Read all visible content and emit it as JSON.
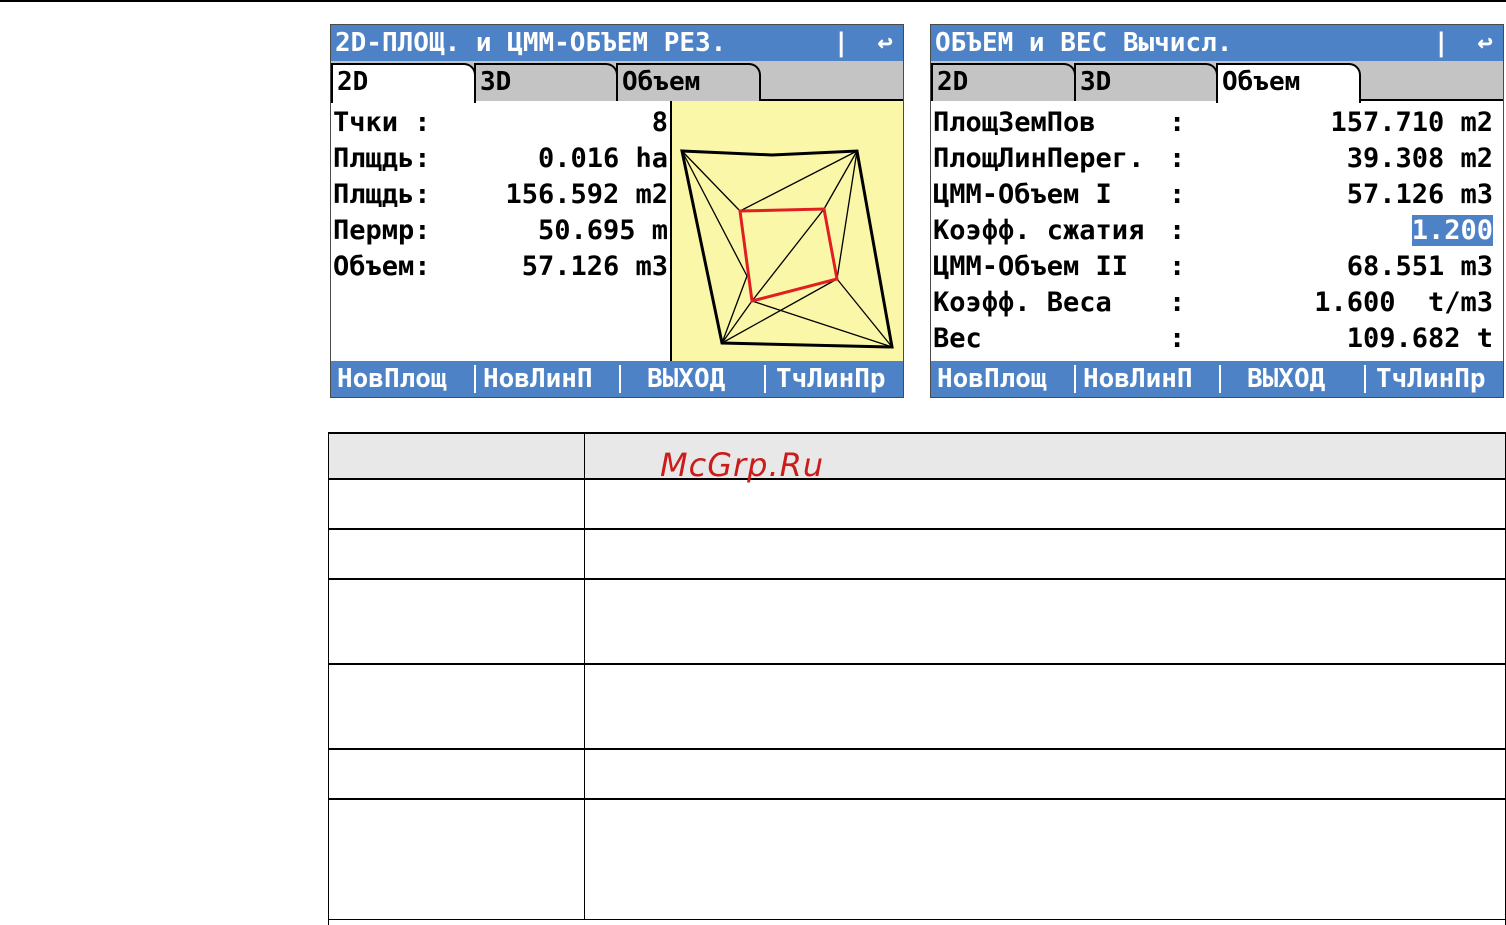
{
  "screen1": {
    "title": "2D-ПЛОЩ. и ЦММ-ОБЪЕМ РЕЗ.",
    "title_sep": "|",
    "back_icon": "↩",
    "tabs": [
      "2D",
      "3D",
      "Объем"
    ],
    "active_tab": "2D",
    "fields": [
      {
        "label": "Тчки  :",
        "value": "8"
      },
      {
        "label": "Плщдь:",
        "value": "0.016 ha"
      },
      {
        "label": "Плщдь:",
        "value": "156.592 m2"
      },
      {
        "label": "Пермр:",
        "value": "50.695 m"
      },
      {
        "label": "Объем:",
        "value": "57.126 m3"
      }
    ],
    "softkeys": [
      "НовПлощ",
      "НовЛинП",
      "ВЫХОД",
      "ТчЛинПр"
    ]
  },
  "screen2": {
    "title": "ОБЪЕМ и ВЕС Вычисл.",
    "title_sep": "|",
    "back_icon": "↩",
    "tabs": [
      "2D",
      "3D",
      "Объем"
    ],
    "active_tab": "Объем",
    "fields": [
      {
        "label": "ПлощЗемПов",
        "colon": ":",
        "value": "157.710 m2"
      },
      {
        "label": "ПлощЛинПерег.",
        "colon": ":",
        "value": "39.308 m2"
      },
      {
        "label": "ЦММ-Объем I",
        "colon": ":",
        "value": "57.126 m3"
      },
      {
        "label": "Коэфф. сжатия",
        "colon": ":",
        "value": "1.200"
      },
      {
        "label": "ЦММ-Объем II",
        "colon": ":",
        "value": "68.551 m3"
      },
      {
        "label": "Коэфф. Веса",
        "colon": ":",
        "value": "1.600  t/m3"
      },
      {
        "label": "Вес",
        "colon": ":",
        "value": "109.682 t"
      }
    ],
    "softkeys": [
      "НовПлощ",
      "НовЛинП",
      "ВЫХОД",
      "ТчЛинПр"
    ]
  },
  "watermark": "McGrp.Ru",
  "colors": {
    "titlebar": "#4d83c6",
    "plot_bg": "#fbf7a8",
    "highlight": "#e02020"
  }
}
